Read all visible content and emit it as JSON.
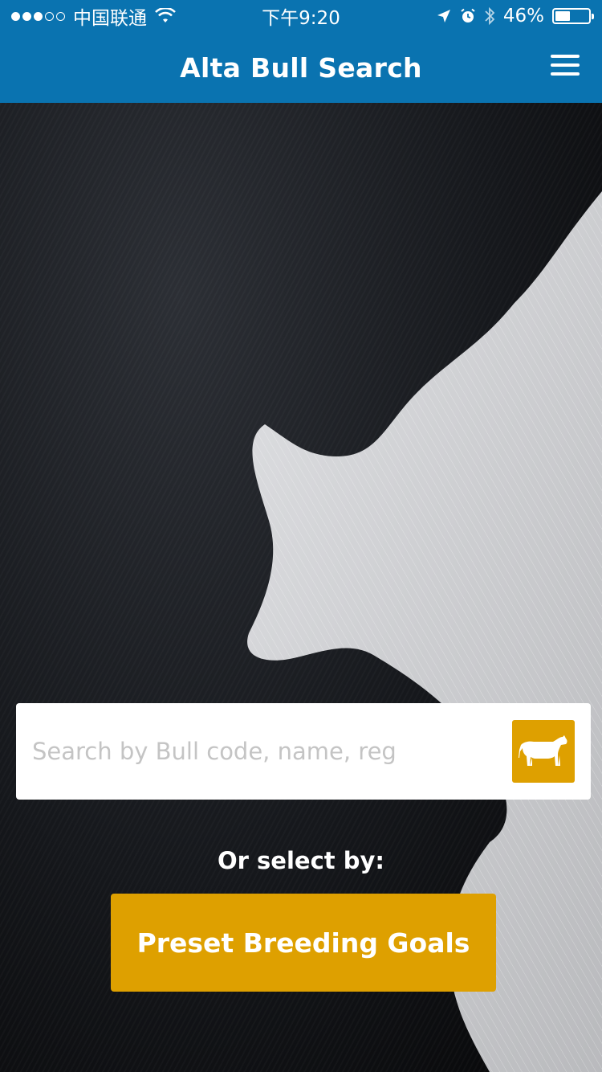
{
  "statusbar": {
    "carrier": "中国联通",
    "time": "下午9:20",
    "battery": "46%",
    "battery_level": 0.46,
    "signal_bars": 3,
    "signal_total": 5,
    "icons": [
      "wifi-icon",
      "location-icon",
      "alarm-icon",
      "bluetooth-icon",
      "battery-icon"
    ]
  },
  "navbar": {
    "title": "Alta Bull Search",
    "menu_icon": "hamburger-menu-icon"
  },
  "search": {
    "placeholder": "Search by Bull code, name, reg",
    "value": "",
    "button_icon": "bull-icon"
  },
  "select": {
    "label": "Or select by:",
    "preset_button": "Preset Breeding Goals"
  },
  "colors": {
    "brand_blue": "#0a73b0",
    "accent_gold": "#dea000"
  },
  "background": "cowhide-image"
}
